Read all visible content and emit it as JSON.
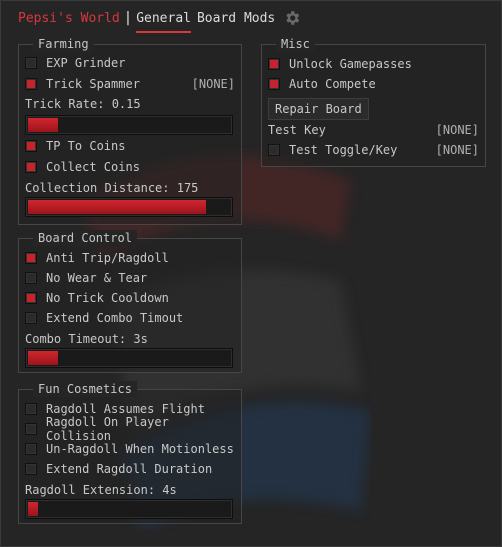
{
  "header": {
    "title": "Pepsi's World",
    "separator": "|",
    "tabs": [
      {
        "label": "General",
        "active": true
      },
      {
        "label": "Board Mods",
        "active": false
      }
    ],
    "settings_icon": "gear-icon"
  },
  "colors": {
    "accent": "#d9363e",
    "fill": "#b81c24",
    "panel": "#252525"
  },
  "farming": {
    "title": "Farming",
    "exp_grinder": {
      "label": "EXP Grinder",
      "checked": false
    },
    "trick_spammer": {
      "label": "Trick Spammer",
      "checked": true,
      "keybind": "[NONE]"
    },
    "trick_rate": {
      "label": "Trick Rate: 0.15",
      "fraction": 0.15
    },
    "tp_to_coins": {
      "label": "TP To Coins",
      "checked": true
    },
    "collect_coins": {
      "label": "Collect Coins",
      "checked": true
    },
    "collection_distance": {
      "label": "Collection Distance: 175",
      "fraction": 0.88
    }
  },
  "misc": {
    "title": "Misc",
    "unlock_gamepasses": {
      "label": "Unlock Gamepasses",
      "checked": true
    },
    "auto_compete": {
      "label": "Auto Compete",
      "checked": true
    },
    "repair_board": {
      "label": "Repair Board"
    },
    "test_key": {
      "label": "Test Key",
      "keybind": "[NONE]"
    },
    "test_toggle": {
      "label": "Test Toggle/Key",
      "checked": false,
      "keybind": "[NONE]"
    }
  },
  "board_control": {
    "title": "Board Control",
    "anti_trip": {
      "label": "Anti Trip/Ragdoll",
      "checked": true
    },
    "no_wear": {
      "label": "No Wear & Tear",
      "checked": false
    },
    "no_trick_cooldown": {
      "label": "No Trick Cooldown",
      "checked": true
    },
    "extend_combo": {
      "label": "Extend Combo Timout",
      "checked": false
    },
    "combo_timeout": {
      "label": "Combo Timeout: 3s",
      "fraction": 0.15
    }
  },
  "fun_cosmetics": {
    "title": "Fun Cosmetics",
    "ragdoll_flight": {
      "label": "Ragdoll Assumes Flight",
      "checked": false
    },
    "ragdoll_collision": {
      "label": "Ragdoll On Player Collision",
      "checked": false
    },
    "unragdoll_motionless": {
      "label": "Un-Ragdoll When Motionless",
      "checked": false
    },
    "extend_ragdoll": {
      "label": "Extend Ragdoll Duration",
      "checked": false
    },
    "ragdoll_extension": {
      "label": "Ragdoll Extension: 4s",
      "fraction": 0.05
    }
  }
}
